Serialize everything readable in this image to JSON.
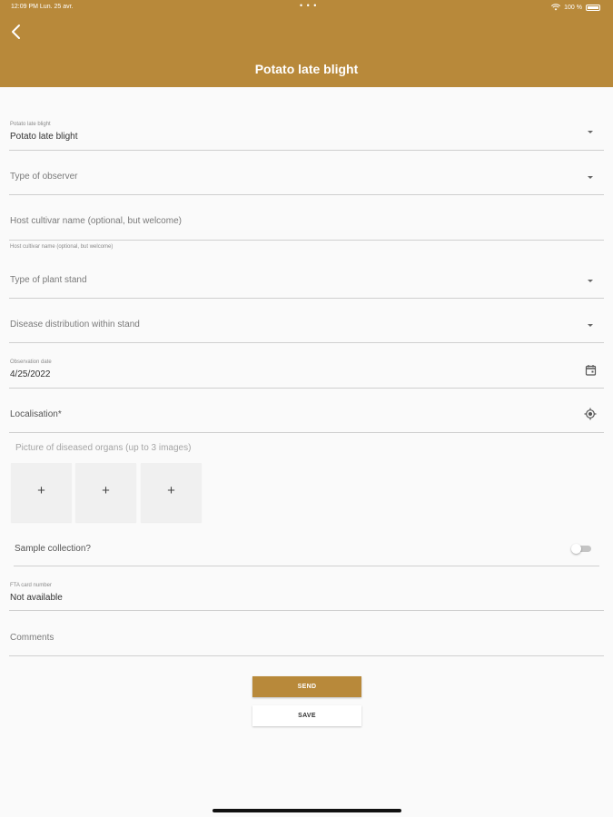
{
  "status_bar": {
    "time": "12:09 PM  Lun. 25 avr.",
    "dots": "• • •",
    "battery": "100 %"
  },
  "header": {
    "title": "Potato late blight"
  },
  "form": {
    "disease": {
      "label": "Potato late blight",
      "value": "Potato late blight"
    },
    "observer": {
      "placeholder": "Type of observer"
    },
    "cultivar": {
      "placeholder": "Host cultivar name (optional, but welcome)",
      "helper": "Host cultivar name (optional, but welcome)"
    },
    "plant_stand": {
      "placeholder": "Type of plant stand"
    },
    "distribution": {
      "placeholder": "Disease distribution within stand"
    },
    "obs_date": {
      "label": "Observation date",
      "value": "4/25/2022"
    },
    "localisation": {
      "placeholder": "Localisation*"
    },
    "photos": {
      "label": "Picture of diseased organs (up to 3 images)",
      "add": "+"
    },
    "sample": {
      "label": "Sample collection?",
      "enabled": false
    },
    "fta": {
      "label": "FTA card number",
      "value": "Not available"
    },
    "comments": {
      "placeholder": "Comments"
    }
  },
  "actions": {
    "send": "SEND",
    "save": "SAVE"
  },
  "colors": {
    "brand": "#b8893a",
    "background": "#fafafa"
  }
}
